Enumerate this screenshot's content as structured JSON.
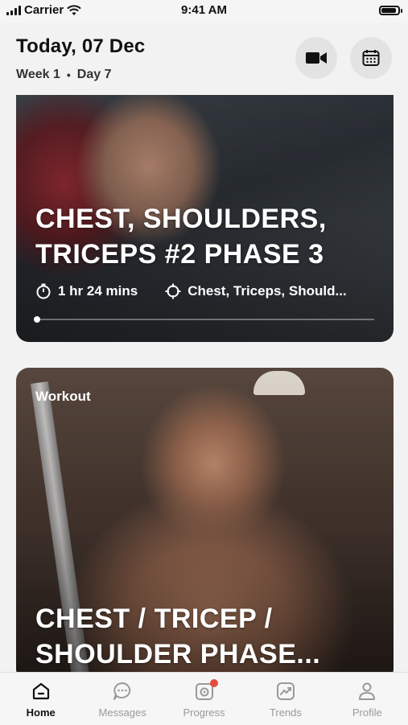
{
  "status_bar": {
    "carrier": "Carrier",
    "time": "9:41 AM",
    "battery_level": 0.9
  },
  "header": {
    "title": "Today, 07 Dec",
    "week": "Week 1",
    "separator": "•",
    "day": "Day 7"
  },
  "icons": {
    "video": "video-camera-icon",
    "calendar": "calendar-icon"
  },
  "cards": [
    {
      "title": "CHEST, SHOULDERS,\nTRICEPS #2 PHASE 3",
      "duration": "1 hr 24 mins",
      "muscles": "Chest, Triceps, Should...",
      "progress": 0.0
    },
    {
      "tag": "Workout",
      "title": "CHEST / TRICEP /\nSHOULDER  PHASE..."
    }
  ],
  "tabs": [
    {
      "label": "Home",
      "icon": "home-icon",
      "active": true
    },
    {
      "label": "Messages",
      "icon": "messages-icon",
      "active": false
    },
    {
      "label": "Progress",
      "icon": "progress-icon",
      "active": false,
      "badge": true
    },
    {
      "label": "Trends",
      "icon": "trends-icon",
      "active": false
    },
    {
      "label": "Profile",
      "icon": "profile-icon",
      "active": false
    }
  ],
  "colors": {
    "badge": "#e74c3c",
    "active_tab": "#111111",
    "inactive_tab": "#999999"
  }
}
